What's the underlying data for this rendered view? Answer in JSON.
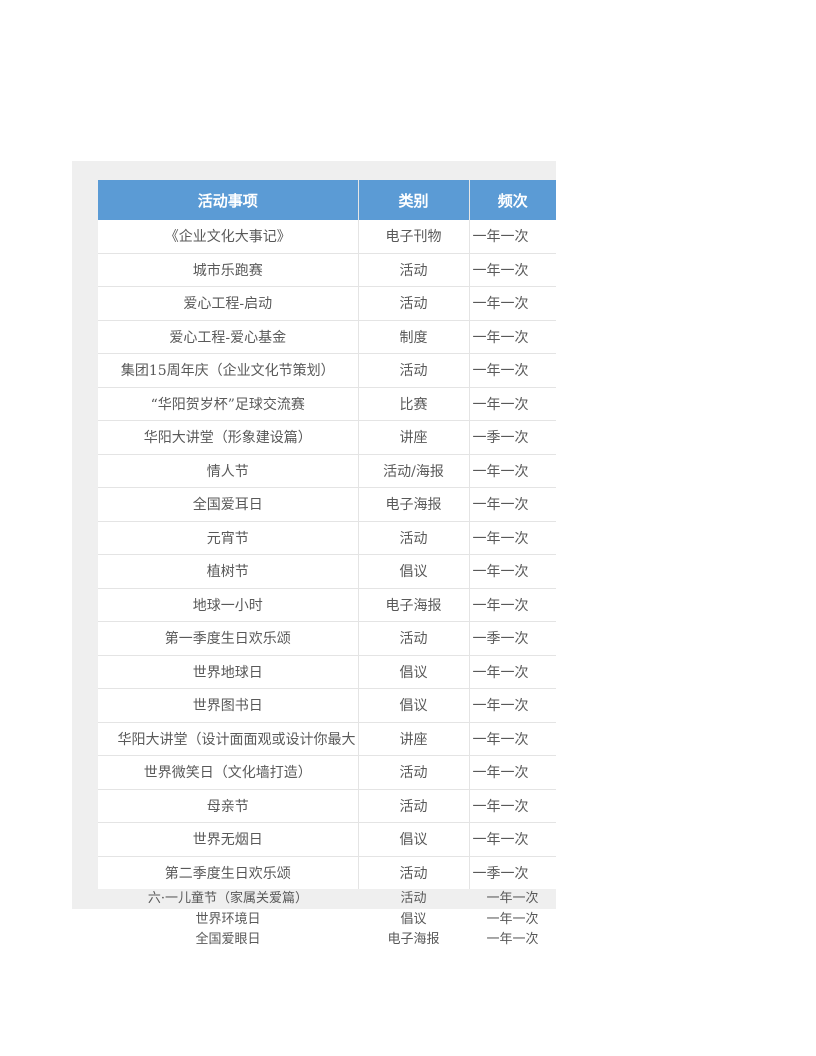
{
  "table": {
    "headers": [
      "活动事项",
      "类别",
      "频次"
    ],
    "rows": [
      [
        "《企业文化大事记》",
        "电子刊物",
        "一年一次"
      ],
      [
        "城市乐跑赛",
        "活动",
        "一年一次"
      ],
      [
        "爱心工程-启动",
        "活动",
        "一年一次"
      ],
      [
        "爱心工程-爱心基金",
        "制度",
        "一年一次"
      ],
      [
        "集团15周年庆（企业文化节策划）",
        "活动",
        "一年一次"
      ],
      [
        "“华阳贺岁杯”足球交流赛",
        "比赛",
        "一年一次"
      ],
      [
        "华阳大讲堂（形象建设篇）",
        "讲座",
        "一季一次"
      ],
      [
        "情人节",
        "活动/海报",
        "一年一次"
      ],
      [
        "全国爱耳日",
        "电子海报",
        "一年一次"
      ],
      [
        "元宵节",
        "活动",
        "一年一次"
      ],
      [
        "植树节",
        "倡议",
        "一年一次"
      ],
      [
        "地球一小时",
        "电子海报",
        "一年一次"
      ],
      [
        "第一季度生日欢乐颂",
        "活动",
        "一季一次"
      ],
      [
        "世界地球日",
        "倡议",
        "一年一次"
      ],
      [
        "世界图书日",
        "倡议",
        "一年一次"
      ],
      [
        "华阳大讲堂（设计面面观或设计你最大",
        "讲座",
        "一年一次"
      ],
      [
        "世界微笑日（文化墙打造）",
        "活动",
        "一年一次"
      ],
      [
        "母亲节",
        "活动",
        "一年一次"
      ],
      [
        "世界无烟日",
        "倡议",
        "一年一次"
      ],
      [
        "第二季度生日欢乐颂",
        "活动",
        "一季一次"
      ]
    ],
    "tail_rows": [
      [
        "六·一儿童节（家属关爱篇）",
        "活动",
        "一年一次"
      ],
      [
        "世界环境日",
        "倡议",
        "一年一次"
      ],
      [
        "全国爱眼日",
        "电子海报",
        "一年一次"
      ]
    ]
  }
}
